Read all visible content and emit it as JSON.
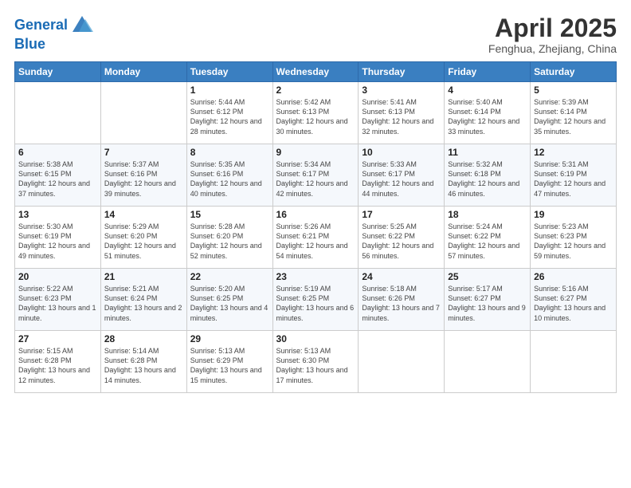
{
  "logo": {
    "line1": "General",
    "line2": "Blue"
  },
  "title": "April 2025",
  "subtitle": "Fenghua, Zhejiang, China",
  "days_of_week": [
    "Sunday",
    "Monday",
    "Tuesday",
    "Wednesday",
    "Thursday",
    "Friday",
    "Saturday"
  ],
  "weeks": [
    [
      {
        "day": "",
        "info": ""
      },
      {
        "day": "",
        "info": ""
      },
      {
        "day": "1",
        "info": "Sunrise: 5:44 AM\nSunset: 6:12 PM\nDaylight: 12 hours and 28 minutes."
      },
      {
        "day": "2",
        "info": "Sunrise: 5:42 AM\nSunset: 6:13 PM\nDaylight: 12 hours and 30 minutes."
      },
      {
        "day": "3",
        "info": "Sunrise: 5:41 AM\nSunset: 6:13 PM\nDaylight: 12 hours and 32 minutes."
      },
      {
        "day": "4",
        "info": "Sunrise: 5:40 AM\nSunset: 6:14 PM\nDaylight: 12 hours and 33 minutes."
      },
      {
        "day": "5",
        "info": "Sunrise: 5:39 AM\nSunset: 6:14 PM\nDaylight: 12 hours and 35 minutes."
      }
    ],
    [
      {
        "day": "6",
        "info": "Sunrise: 5:38 AM\nSunset: 6:15 PM\nDaylight: 12 hours and 37 minutes."
      },
      {
        "day": "7",
        "info": "Sunrise: 5:37 AM\nSunset: 6:16 PM\nDaylight: 12 hours and 39 minutes."
      },
      {
        "day": "8",
        "info": "Sunrise: 5:35 AM\nSunset: 6:16 PM\nDaylight: 12 hours and 40 minutes."
      },
      {
        "day": "9",
        "info": "Sunrise: 5:34 AM\nSunset: 6:17 PM\nDaylight: 12 hours and 42 minutes."
      },
      {
        "day": "10",
        "info": "Sunrise: 5:33 AM\nSunset: 6:17 PM\nDaylight: 12 hours and 44 minutes."
      },
      {
        "day": "11",
        "info": "Sunrise: 5:32 AM\nSunset: 6:18 PM\nDaylight: 12 hours and 46 minutes."
      },
      {
        "day": "12",
        "info": "Sunrise: 5:31 AM\nSunset: 6:19 PM\nDaylight: 12 hours and 47 minutes."
      }
    ],
    [
      {
        "day": "13",
        "info": "Sunrise: 5:30 AM\nSunset: 6:19 PM\nDaylight: 12 hours and 49 minutes."
      },
      {
        "day": "14",
        "info": "Sunrise: 5:29 AM\nSunset: 6:20 PM\nDaylight: 12 hours and 51 minutes."
      },
      {
        "day": "15",
        "info": "Sunrise: 5:28 AM\nSunset: 6:20 PM\nDaylight: 12 hours and 52 minutes."
      },
      {
        "day": "16",
        "info": "Sunrise: 5:26 AM\nSunset: 6:21 PM\nDaylight: 12 hours and 54 minutes."
      },
      {
        "day": "17",
        "info": "Sunrise: 5:25 AM\nSunset: 6:22 PM\nDaylight: 12 hours and 56 minutes."
      },
      {
        "day": "18",
        "info": "Sunrise: 5:24 AM\nSunset: 6:22 PM\nDaylight: 12 hours and 57 minutes."
      },
      {
        "day": "19",
        "info": "Sunrise: 5:23 AM\nSunset: 6:23 PM\nDaylight: 12 hours and 59 minutes."
      }
    ],
    [
      {
        "day": "20",
        "info": "Sunrise: 5:22 AM\nSunset: 6:23 PM\nDaylight: 13 hours and 1 minute."
      },
      {
        "day": "21",
        "info": "Sunrise: 5:21 AM\nSunset: 6:24 PM\nDaylight: 13 hours and 2 minutes."
      },
      {
        "day": "22",
        "info": "Sunrise: 5:20 AM\nSunset: 6:25 PM\nDaylight: 13 hours and 4 minutes."
      },
      {
        "day": "23",
        "info": "Sunrise: 5:19 AM\nSunset: 6:25 PM\nDaylight: 13 hours and 6 minutes."
      },
      {
        "day": "24",
        "info": "Sunrise: 5:18 AM\nSunset: 6:26 PM\nDaylight: 13 hours and 7 minutes."
      },
      {
        "day": "25",
        "info": "Sunrise: 5:17 AM\nSunset: 6:27 PM\nDaylight: 13 hours and 9 minutes."
      },
      {
        "day": "26",
        "info": "Sunrise: 5:16 AM\nSunset: 6:27 PM\nDaylight: 13 hours and 10 minutes."
      }
    ],
    [
      {
        "day": "27",
        "info": "Sunrise: 5:15 AM\nSunset: 6:28 PM\nDaylight: 13 hours and 12 minutes."
      },
      {
        "day": "28",
        "info": "Sunrise: 5:14 AM\nSunset: 6:28 PM\nDaylight: 13 hours and 14 minutes."
      },
      {
        "day": "29",
        "info": "Sunrise: 5:13 AM\nSunset: 6:29 PM\nDaylight: 13 hours and 15 minutes."
      },
      {
        "day": "30",
        "info": "Sunrise: 5:13 AM\nSunset: 6:30 PM\nDaylight: 13 hours and 17 minutes."
      },
      {
        "day": "",
        "info": ""
      },
      {
        "day": "",
        "info": ""
      },
      {
        "day": "",
        "info": ""
      }
    ]
  ]
}
